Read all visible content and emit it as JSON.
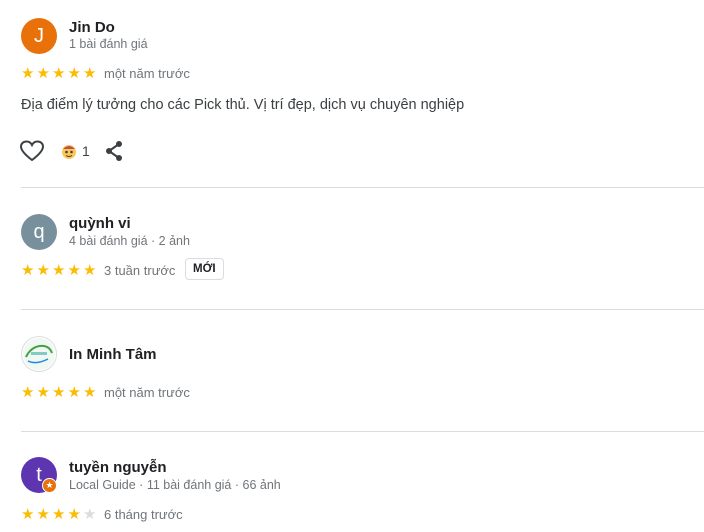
{
  "reviews": [
    {
      "avatar_letter": "J",
      "avatar_color": "#e8710a",
      "name": "Jin Do",
      "meta": "1 bài đánh giá",
      "rating": 5,
      "time": "một năm trước",
      "text": "Địa điểm lý tưởng cho các Pick thủ. Vị trí đẹp, dịch vụ chuyên nghiệp",
      "reaction_count": "1"
    },
    {
      "avatar_letter": "q",
      "avatar_color": "#78909c",
      "name": "quỳnh vi",
      "meta": "4 bài đánh giá · 2 ảnh",
      "rating": 5,
      "time": "3 tuần trước",
      "badge": "MỚI"
    },
    {
      "name": "In Minh Tâm",
      "rating": 5,
      "time": "một năm trước"
    },
    {
      "avatar_letter": "t",
      "avatar_color": "#5e35b1",
      "name": "tuyền nguyễn",
      "meta": "Local Guide · 11 bài đánh giá · 66 ảnh",
      "rating": 4,
      "time": "6 tháng trước"
    }
  ]
}
